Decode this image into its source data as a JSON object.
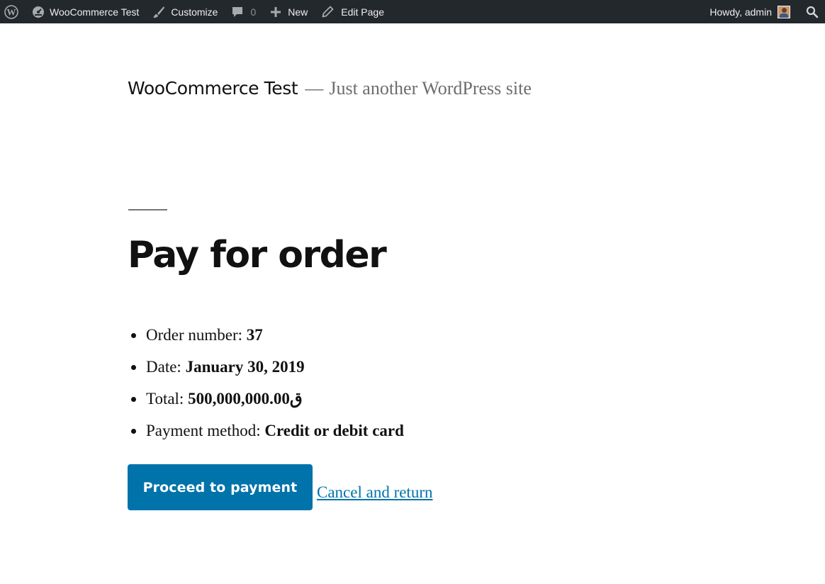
{
  "admin_bar": {
    "site_name": "WooCommerce Test",
    "customize": "Customize",
    "comments_count": "0",
    "new": "New",
    "edit_page": "Edit Page",
    "howdy": "Howdy, admin",
    "icons": [
      "wordpress-logo-icon",
      "dashboard-icon",
      "brush-icon",
      "comment-icon",
      "plus-icon",
      "pencil-icon",
      "avatar",
      "search-icon"
    ]
  },
  "header": {
    "site_title": "WooCommerce Test",
    "dash": "—",
    "tagline": "Just another WordPress site"
  },
  "page": {
    "title": "Pay for order"
  },
  "order": {
    "number_label": "Order number: ",
    "number_value": "37",
    "date_label": "Date: ",
    "date_value": "January 30, 2019",
    "total_label": "Total: ",
    "total_value": "ق500,000,000.00",
    "method_label": "Payment method: ",
    "method_value": "Credit or debit card"
  },
  "actions": {
    "pay_button": "Proceed to payment",
    "cancel_link": "Cancel and return"
  },
  "colors": {
    "admin_bar_bg": "#23282d",
    "button_bg": "#0073aa",
    "link": "#0073aa",
    "text": "#111111",
    "muted": "#6d6d6d"
  }
}
